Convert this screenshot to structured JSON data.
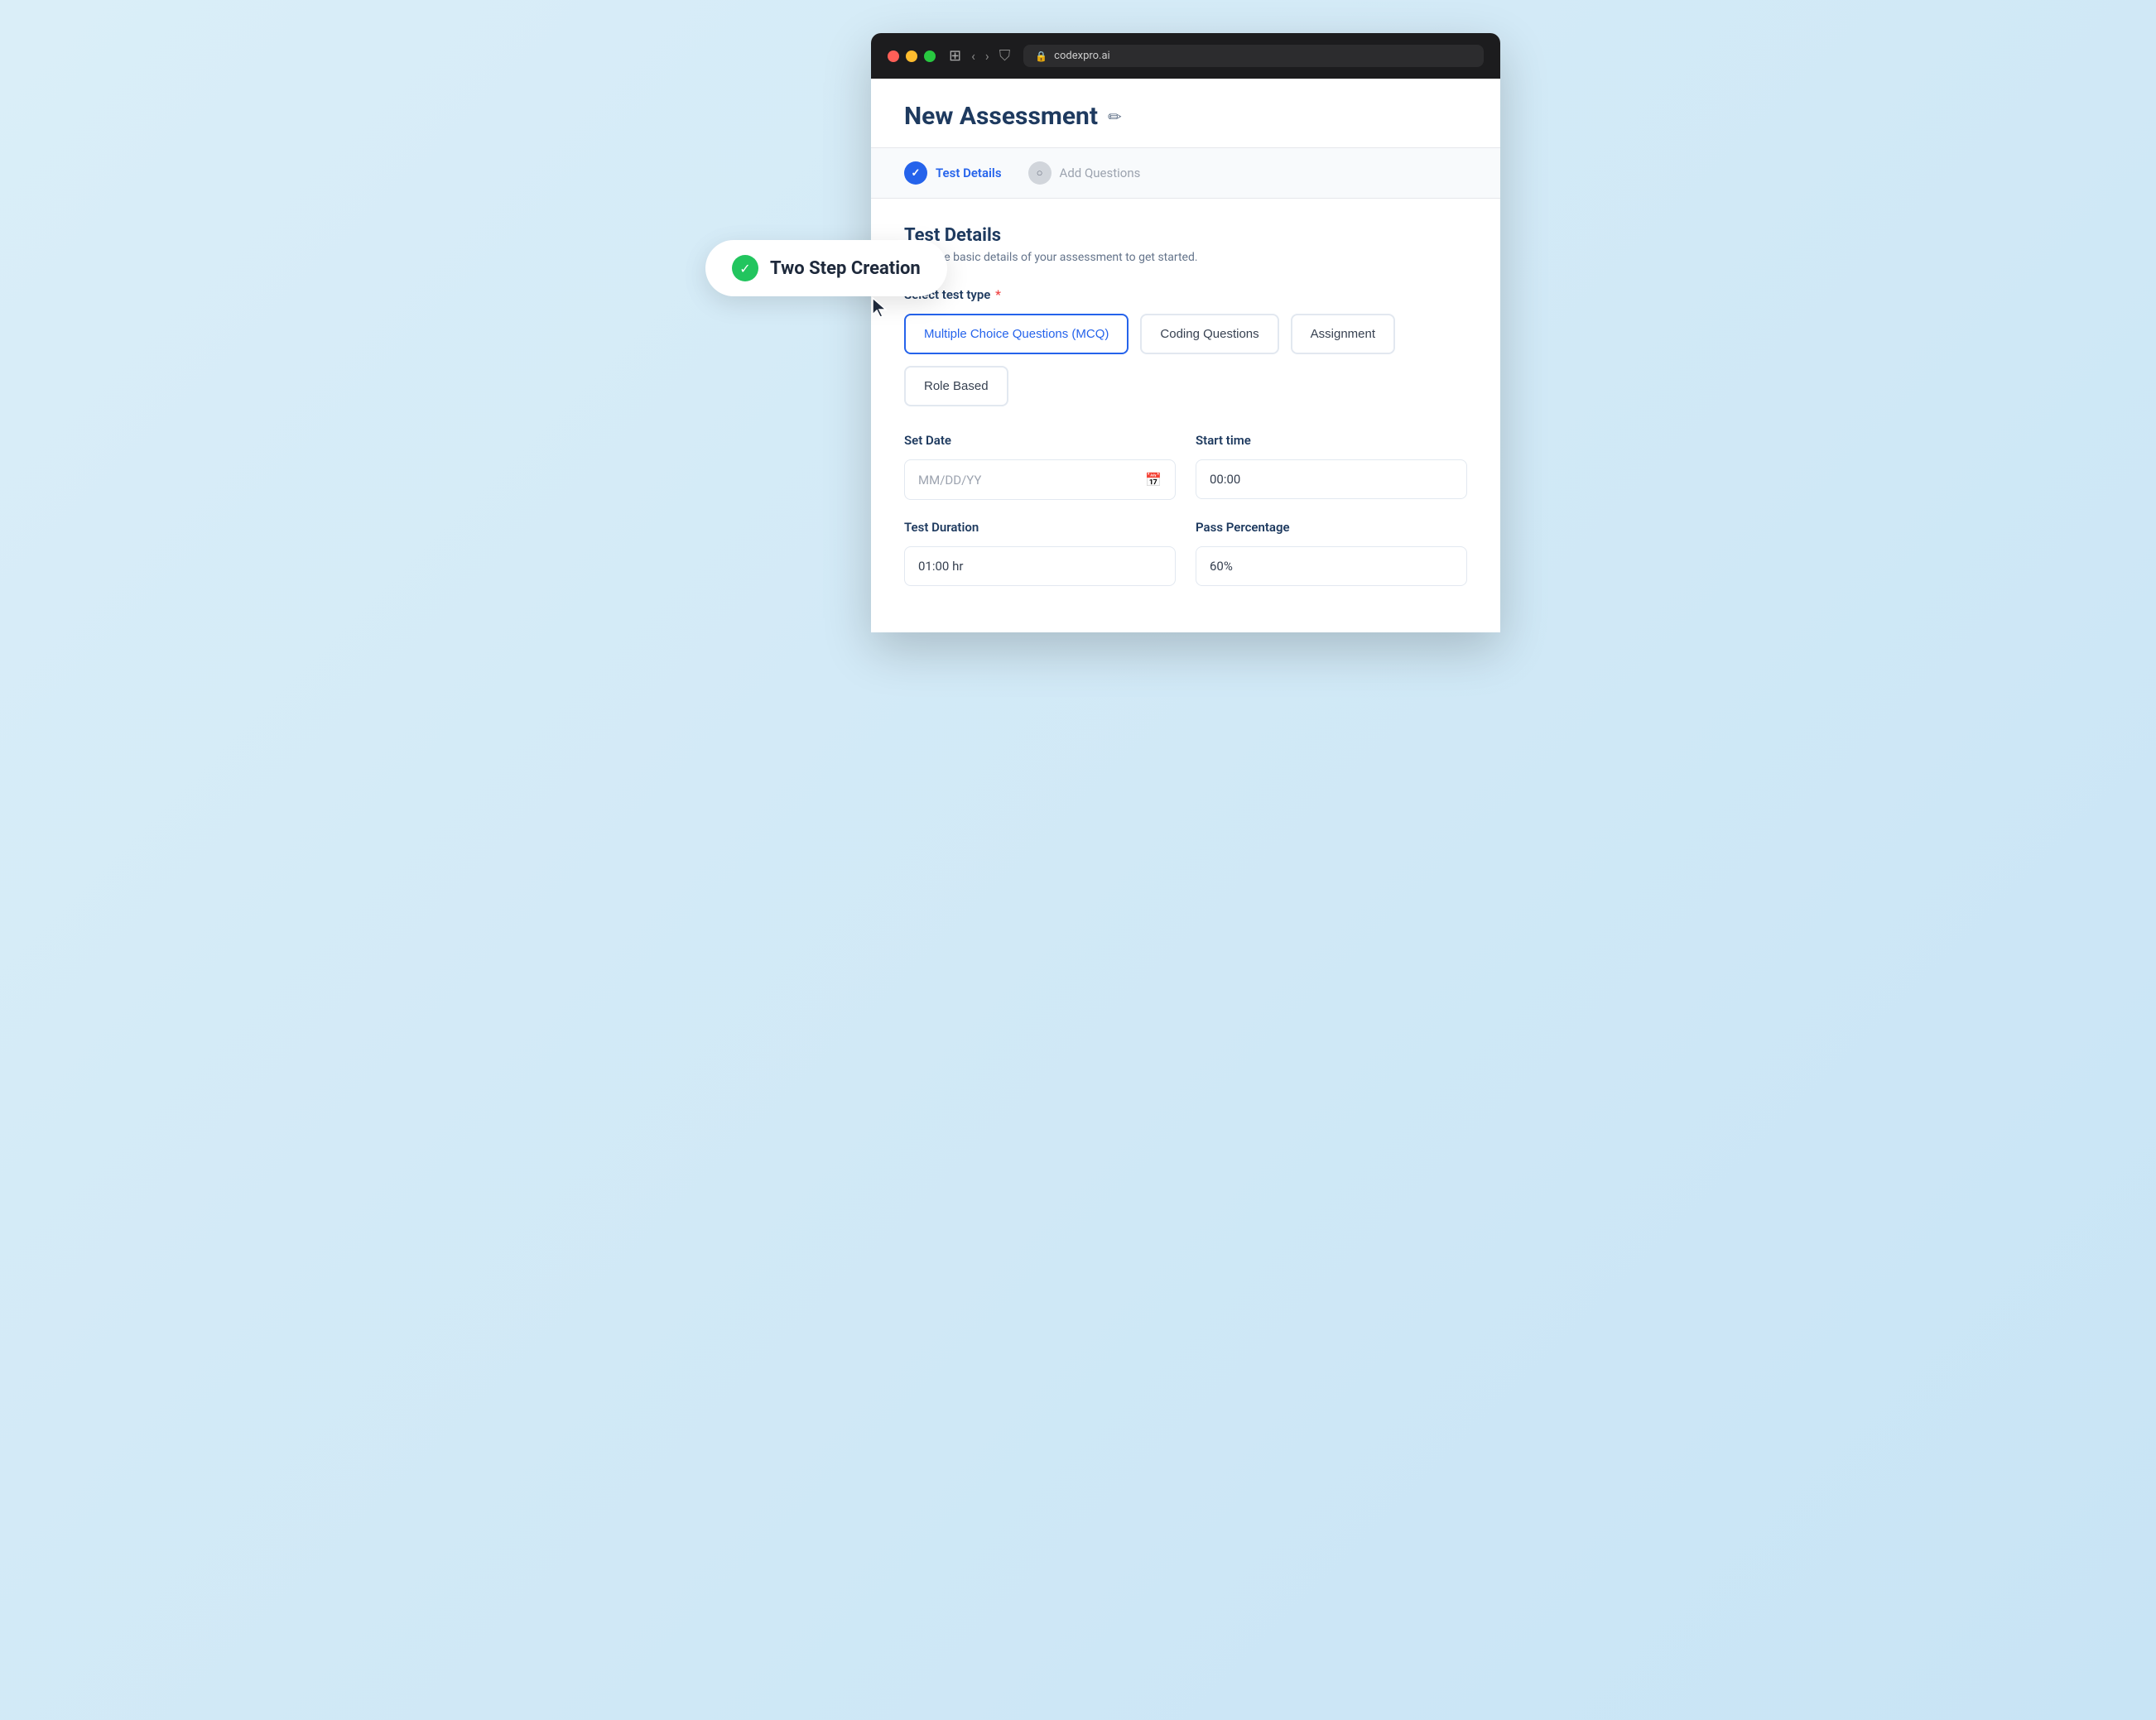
{
  "browser": {
    "url": "codexpro.ai"
  },
  "tooltip": {
    "label": "Two Step Creation",
    "shield_icon": "✓"
  },
  "page": {
    "title": "New Assessment",
    "edit_icon": "✏"
  },
  "steps": [
    {
      "id": "test-details",
      "label": "Test Details",
      "state": "active",
      "icon": "✓"
    },
    {
      "id": "add-questions",
      "label": "Add Questions",
      "state": "inactive",
      "icon": "○"
    }
  ],
  "form": {
    "section_title": "Test Details",
    "section_desc": "Enter the basic details of your assessment to get started.",
    "test_type_label": "Select test type",
    "test_types": [
      {
        "id": "mcq",
        "label": "Multiple Choice Questions (MCQ)",
        "active": true
      },
      {
        "id": "coding",
        "label": "Coding Questions",
        "active": false
      },
      {
        "id": "assignment",
        "label": "Assignment",
        "active": false
      },
      {
        "id": "role-based",
        "label": "Role Based",
        "active": false
      }
    ],
    "set_date_label": "Set Date",
    "set_date_placeholder": "MM/DD/YY",
    "start_time_label": "Start time",
    "start_time_value": "00:00",
    "test_duration_label": "Test Duration",
    "test_duration_value": "01:00 hr",
    "pass_percentage_label": "Pass Percentage",
    "pass_percentage_value": "60%"
  },
  "colors": {
    "active_blue": "#2563eb",
    "dark_navy": "#1e3a5f",
    "light_bg": "#daeef8"
  }
}
